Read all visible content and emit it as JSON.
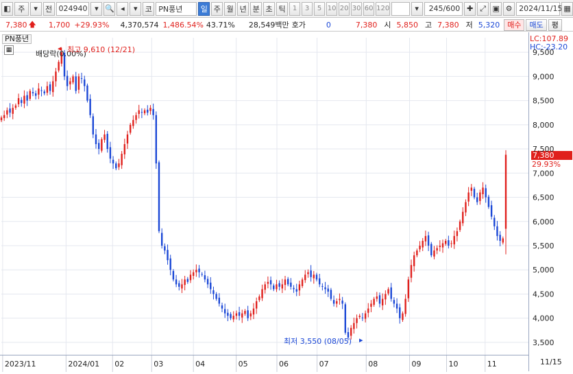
{
  "toolbar": {
    "market": "주",
    "prev_label": "전",
    "code": "024940",
    "market2": "코",
    "name": "PN풍년",
    "periods": [
      "일",
      "주",
      "월",
      "년",
      "분",
      "초",
      "틱"
    ],
    "selected_period": "일",
    "numbers": [
      "1",
      "3",
      "5",
      "10",
      "20",
      "30",
      "60",
      "120"
    ],
    "count": "245/600",
    "date": "2024/11/15"
  },
  "quote": {
    "price": "7,380",
    "change": "1,700",
    "change_pct": "+29.93%",
    "volume": "4,370,574",
    "volume_pct": "1,486.54%",
    "turnover_pct": "43.71%",
    "amount": "28,549백만",
    "hoga_label": "호가",
    "hoga_value": "0",
    "hoga_price": "7,380",
    "open_label": "시",
    "open": "5,850",
    "high_label": "고",
    "high": "7,380",
    "low_label": "저",
    "low": "5,320",
    "buy": "매수",
    "sell": "매도",
    "more": "평"
  },
  "chart_panel": {
    "title": "PN풍년",
    "dividend_label": "배당락(0.00%)",
    "max_label": "최고 9,610 (12/21)",
    "min_label": "최저 3,550 (08/05)",
    "lc": "LC:107.89",
    "hc": "HC:-23.20",
    "current_price": "7,380",
    "current_pct": "29.93%"
  },
  "chart_data": {
    "type": "candlestick",
    "y_ticks": [
      "9,500",
      "9,000",
      "8,500",
      "8,000",
      "7,500",
      "7,000",
      "6,500",
      "6,000",
      "5,500",
      "5,000",
      "4,500",
      "4,000",
      "3,500"
    ],
    "x_ticks": [
      "2023/11",
      "2024/01",
      "02",
      "03",
      "04",
      "05",
      "06",
      "07",
      "08",
      "09",
      "10",
      "11",
      "11/15"
    ],
    "ylim": [
      3300,
      9800
    ],
    "up_color": "#e0201c",
    "down_color": "#1a47d6",
    "closes": [
      8150,
      8200,
      8300,
      8250,
      8350,
      8400,
      8550,
      8450,
      8600,
      8500,
      8700,
      8650,
      8600,
      8750,
      8700,
      8650,
      8800,
      8700,
      8900,
      9100,
      9300,
      9500,
      9000,
      8800,
      8900,
      9000,
      8700,
      9000,
      8950,
      8800,
      8500,
      8200,
      7800,
      7600,
      7500,
      7700,
      7800,
      7500,
      7300,
      7200,
      7100,
      7200,
      7400,
      7600,
      7800,
      8000,
      8100,
      8200,
      8300,
      8250,
      8300,
      8250,
      8350,
      8200,
      7200,
      5800,
      5500,
      5400,
      5200,
      5000,
      4800,
      4700,
      4650,
      4700,
      4800,
      4750,
      4900,
      4950,
      5000,
      4950,
      4900,
      4800,
      4700,
      4600,
      4500,
      4400,
      4300,
      4200,
      4100,
      4050,
      4000,
      4050,
      4100,
      4050,
      4100,
      4150,
      4000,
      4100,
      4200,
      4350,
      4450,
      4600,
      4700,
      4750,
      4700,
      4600,
      4700,
      4650,
      4700,
      4800,
      4700,
      4650,
      4600,
      4550,
      4700,
      4800,
      4900,
      4950,
      4850,
      4900,
      4800,
      4700,
      4650,
      4600,
      4550,
      4400,
      4300,
      4350,
      4400,
      4300,
      3700,
      3600,
      3800,
      3900,
      4000,
      4050,
      4000,
      4100,
      4200,
      4300,
      4400,
      4450,
      4300,
      4400,
      4500,
      4600,
      4400,
      4300,
      4200,
      4000,
      4100,
      4400,
      4800,
      5100,
      5300,
      5400,
      5500,
      5600,
      5700,
      5500,
      5300,
      5400,
      5450,
      5500,
      5550,
      5600,
      5500,
      5550,
      5700,
      5800,
      6000,
      6200,
      6400,
      6600,
      6700,
      6500,
      6400,
      6600,
      6700,
      6500,
      6300,
      6100,
      5900,
      5700,
      5600,
      5650,
      7380
    ]
  }
}
